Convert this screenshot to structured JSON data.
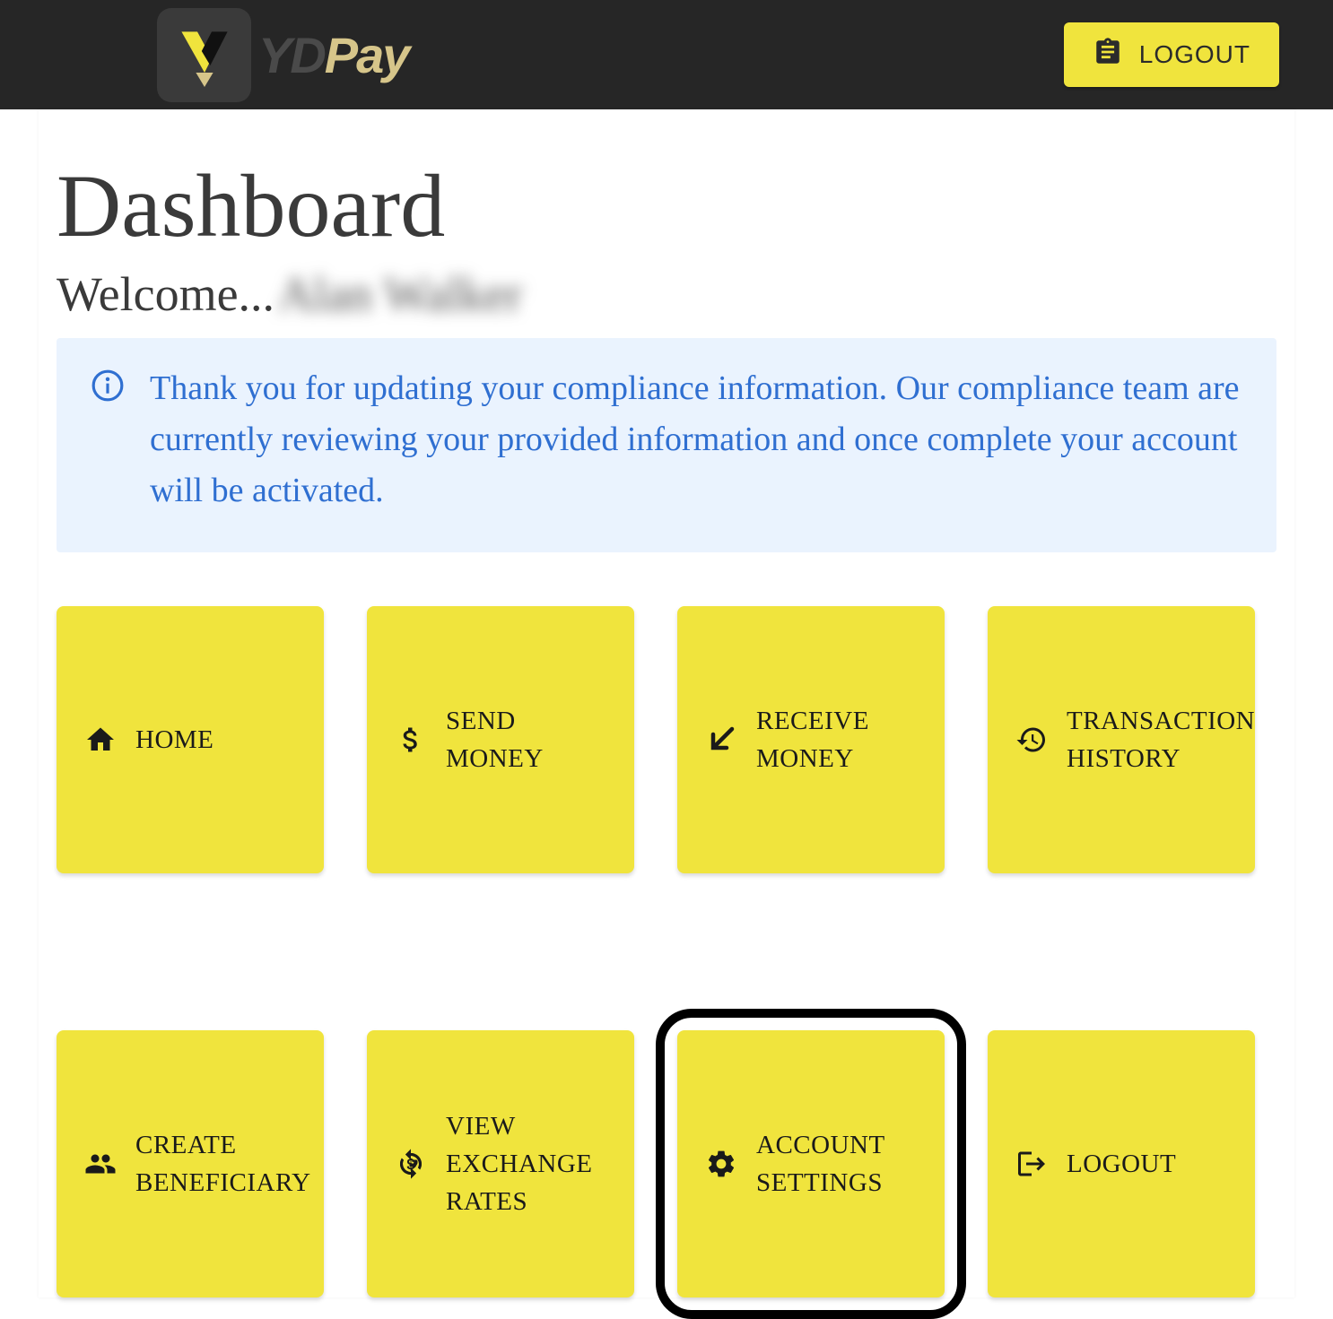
{
  "brand": {
    "name_part_1": "YD",
    "name_part_2": "Pay"
  },
  "header": {
    "logout_label": "LOGOUT"
  },
  "page": {
    "title": "Dashboard",
    "welcome_prefix": "Welcome...",
    "welcome_name": "Alan Walker"
  },
  "alert": {
    "message": "Thank you for updating your compliance information. Our compliance team are currently reviewing your provided information and once complete your account will be activated."
  },
  "tiles": [
    {
      "icon": "home-icon",
      "label": "HOME"
    },
    {
      "icon": "dollar-icon",
      "label": "SEND MONEY"
    },
    {
      "icon": "arrow-down-left-icon",
      "label": "RECEIVE MONEY"
    },
    {
      "icon": "history-icon",
      "label": "TRANSACTION HISTORY"
    },
    {
      "icon": "people-icon",
      "label": "CREATE BENEFICIARY"
    },
    {
      "icon": "exchange-icon",
      "label": "VIEW EXCHANGE RATES"
    },
    {
      "icon": "gear-icon",
      "label": "ACCOUNT SETTINGS",
      "highlight": true
    },
    {
      "icon": "logout-icon",
      "label": "LOGOUT"
    }
  ]
}
